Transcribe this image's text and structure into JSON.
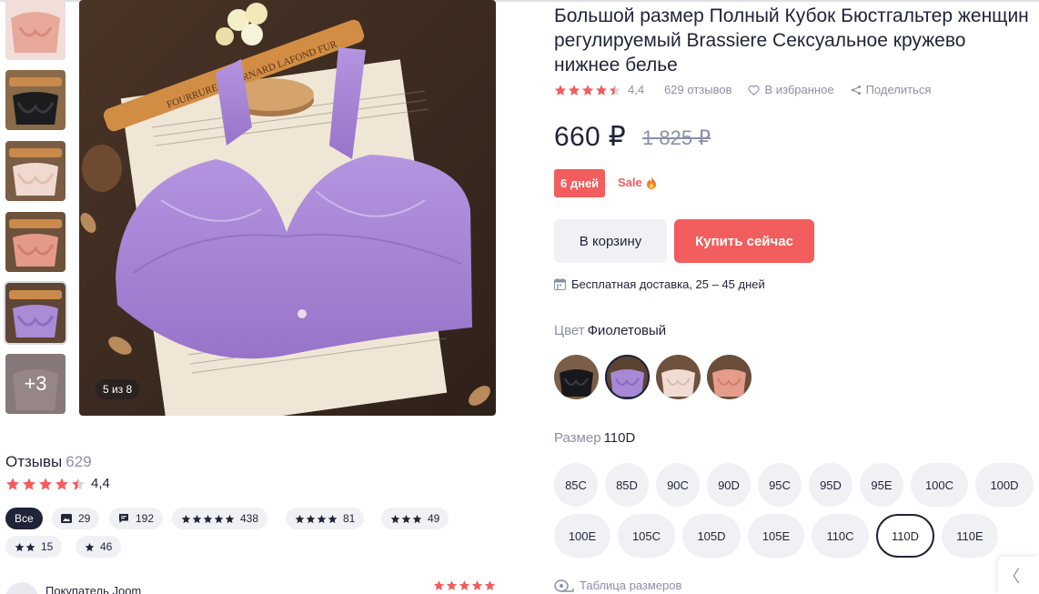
{
  "product": {
    "title": "Большой размер Полный Кубок Бюстгальтер женщин регулируемый Brassiere Сексуальное кружево нижнее белье",
    "rating": "4,4",
    "rating_value": 4.4,
    "reviews_count_label": "629 отзывов",
    "favorites_label": "В избранное",
    "share_label": "Поделиться",
    "price": "660 ₽",
    "old_price": "1 825 ₽",
    "days_badge": "6 дней",
    "sale_label": "Sale",
    "add_to_cart_label": "В корзину",
    "buy_now_label": "Купить сейчас",
    "delivery_text": "Бесплатная доставка, 25 – 45 дней",
    "color_label": "Цвет",
    "color_value": "Фиолетовый",
    "size_label": "Размер",
    "size_value": "110D",
    "size_table_label": "Таблица размеров",
    "colors": [
      "black",
      "purple",
      "beige",
      "pink"
    ],
    "selected_color": "purple",
    "sizes": [
      "85C",
      "85D",
      "90C",
      "90D",
      "95C",
      "95D",
      "95E",
      "100C",
      "100D",
      "100E",
      "105C",
      "105D",
      "105E",
      "110C",
      "110D",
      "110E"
    ],
    "selected_size": "110D"
  },
  "gallery": {
    "counter": "5 из 8",
    "more_label": "+3",
    "thumbnails": [
      "pink",
      "black",
      "beige",
      "pink",
      "purple",
      "more"
    ],
    "active_index": 4
  },
  "reviews": {
    "title": "Отзывы",
    "count": "629",
    "rating": "4,4",
    "filters": [
      {
        "label": "Все",
        "active": true
      },
      {
        "icon": "photo-icon",
        "label": "29"
      },
      {
        "icon": "comment-icon",
        "label": "192"
      },
      {
        "stars": 5,
        "label": "438"
      },
      {
        "stars": 4,
        "label": "81"
      },
      {
        "stars": 3,
        "label": "49"
      },
      {
        "stars": 2,
        "label": "15"
      },
      {
        "stars": 1,
        "label": "46"
      }
    ],
    "first_review": {
      "author": "Покупатель Joom",
      "stars": 5
    }
  },
  "colors": {
    "accent": "#f25d5d",
    "text": "#1f2438",
    "muted": "#8a90a8",
    "chip_bg": "#f0f1f5"
  }
}
